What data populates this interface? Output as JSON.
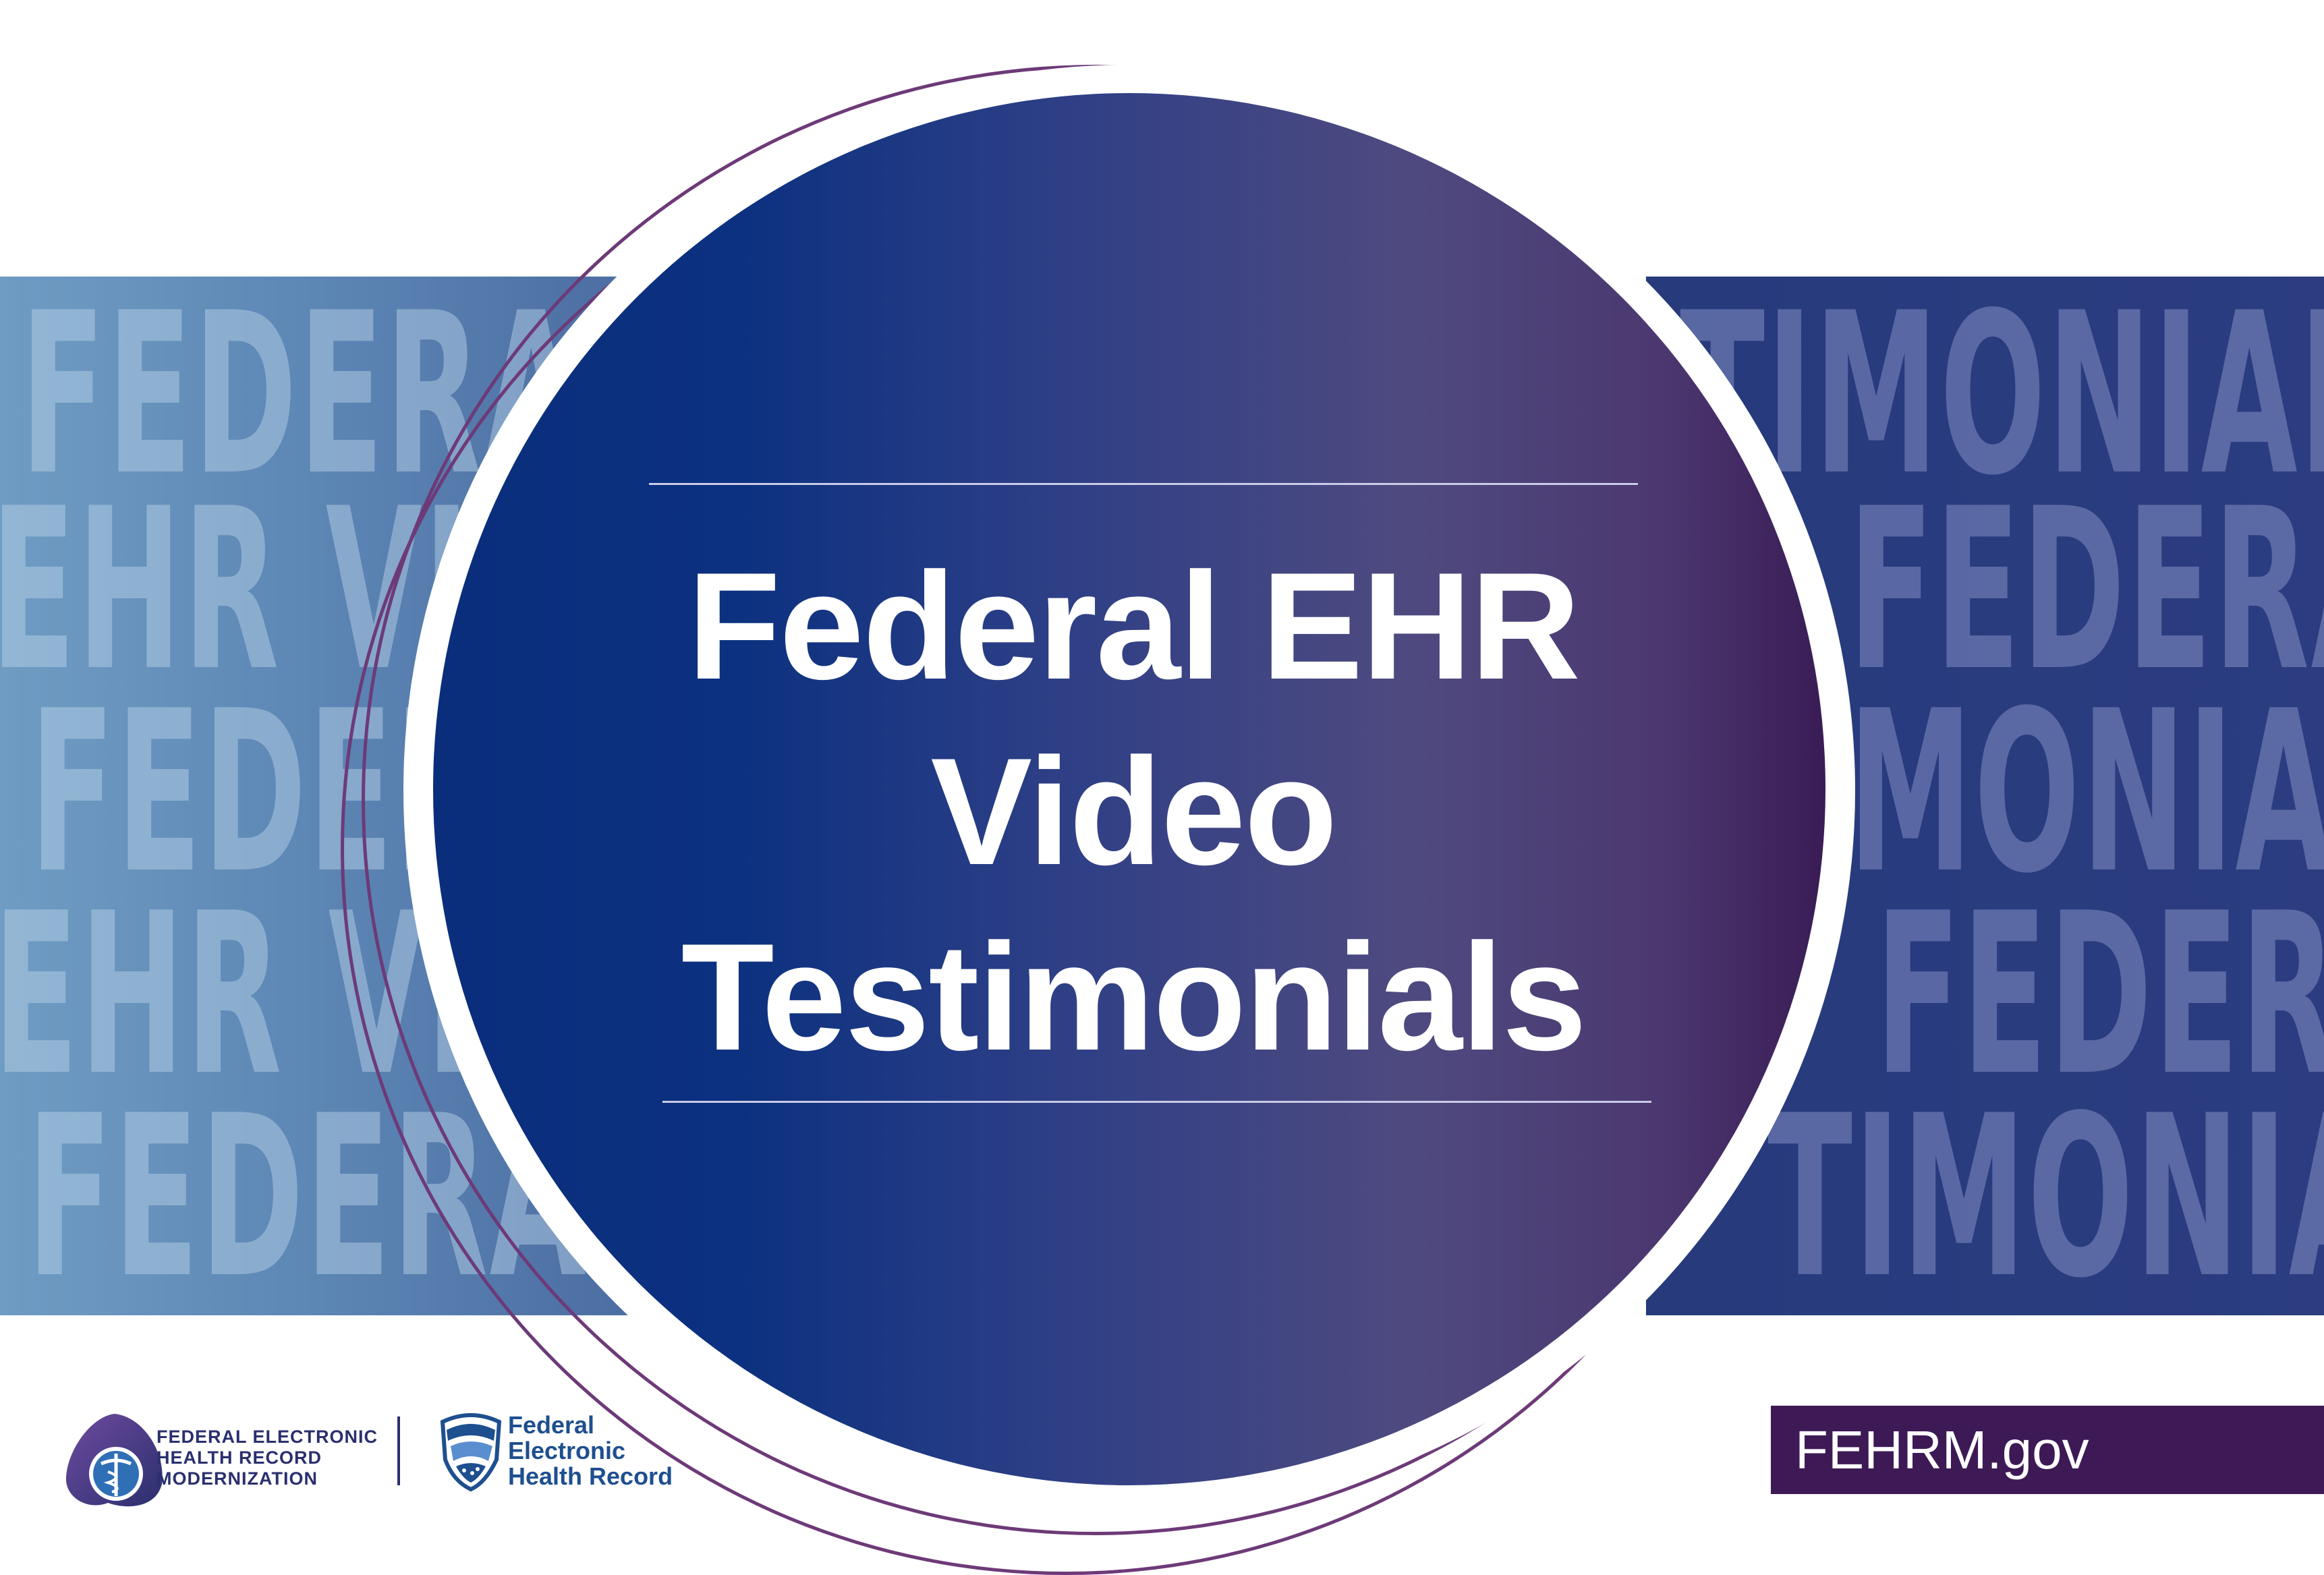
{
  "title": {
    "line1": "Federal EHR",
    "line2": "Video",
    "line3": "Testimonials"
  },
  "background_text": {
    "left_rows": [
      "FEDERAL",
      "EHR VI",
      "FEDER",
      "EHR VI",
      "FEDERAL"
    ],
    "right_rows": [
      "TIMONIAL",
      "FEDERA",
      "MONIAL",
      "FEDERA",
      "TIMONIAL"
    ]
  },
  "logos": {
    "fehrm": {
      "line1": "FEDERAL ELECTRONIC",
      "line2": "HEALTH RECORD",
      "line3": "MODERNIZATION",
      "icon": "caduceus-logo-icon"
    },
    "fehr": {
      "line1": "Federal",
      "line2": "Electronic",
      "line3": "Health Record",
      "icon": "shield-logo-icon"
    }
  },
  "url": "FEHRM.gov",
  "colors": {
    "navy": "#0a2e7c",
    "purple": "#3d1a55",
    "accent_outline": "#6d3a78",
    "band_left": "#5d87b5",
    "band_right": "#2b3d80"
  }
}
